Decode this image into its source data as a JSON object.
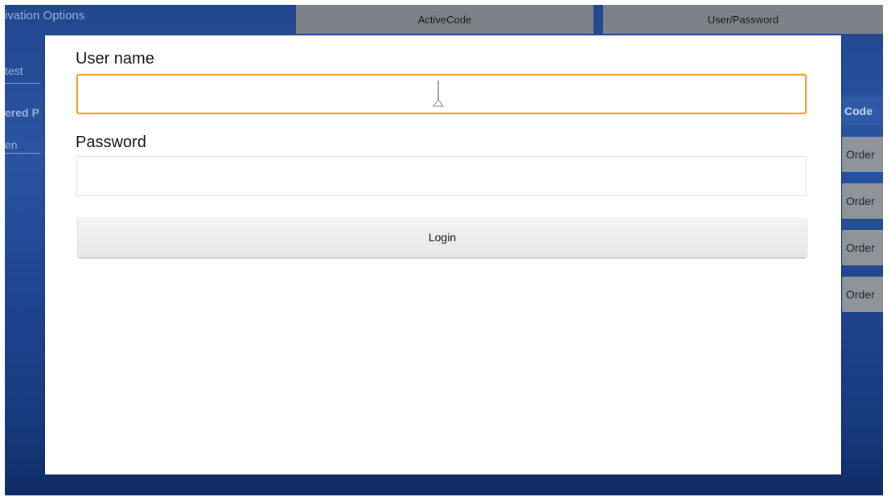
{
  "background": {
    "title": "ivation Options",
    "tabs": [
      {
        "label": "ActiveCode"
      },
      {
        "label": "User/Password"
      }
    ],
    "left_labels": [
      "test",
      "ered P",
      "en"
    ],
    "right_header": "Code",
    "order_buttons": [
      "Order",
      "Order",
      "Order",
      "Order"
    ],
    "colors": {
      "background": "#22478e",
      "tab": "#7e8288",
      "order_button": "#8f949b"
    }
  },
  "modal": {
    "username_label": "User name",
    "username_value": "",
    "password_label": "Password",
    "password_value": "",
    "login_label": "Login",
    "colors": {
      "focus_border": "#f0a131",
      "button": "#e9e9e9"
    }
  }
}
